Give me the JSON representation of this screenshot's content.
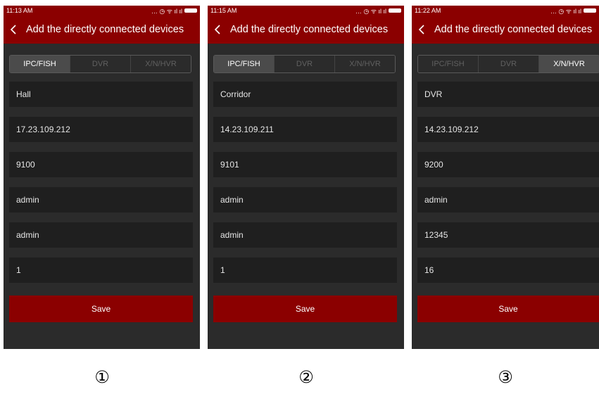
{
  "screens": [
    {
      "status_time": "11:13 AM",
      "status_icons": "… ◷ ᯤ ıl ıl",
      "title": "Add the directly connected devices",
      "tabs": [
        {
          "label": "IPC/FISH",
          "active": true
        },
        {
          "label": "DVR",
          "active": false
        },
        {
          "label": "X/N/HVR",
          "active": false
        }
      ],
      "fields": [
        "Hall",
        "17.23.109.212",
        "9100",
        "admin",
        "admin",
        "1"
      ],
      "save_label": "Save",
      "index_label": "①"
    },
    {
      "status_time": "11:15 AM",
      "status_icons": "… ◷ ᯤ ıl ıl",
      "title": "Add the directly connected devices",
      "tabs": [
        {
          "label": "IPC/FISH",
          "active": true
        },
        {
          "label": "DVR",
          "active": false
        },
        {
          "label": "X/N/HVR",
          "active": false
        }
      ],
      "fields": [
        "Corridor",
        "14.23.109.211",
        "9101",
        "admin",
        "admin",
        "1"
      ],
      "save_label": "Save",
      "index_label": "②"
    },
    {
      "status_time": "11:22 AM",
      "status_icons": "… ◷ ᯤ ıl ıl",
      "title": "Add the directly connected devices",
      "tabs": [
        {
          "label": "IPC/FISH",
          "active": false
        },
        {
          "label": "DVR",
          "active": false
        },
        {
          "label": "X/N/HVR",
          "active": true
        }
      ],
      "fields": [
        "DVR",
        "14.23.109.212",
        "9200",
        "admin",
        "12345",
        "16"
      ],
      "save_label": "Save",
      "index_label": "③"
    }
  ],
  "colors": {
    "brand_red": "#8b0000",
    "background": "#2b2b2b",
    "field_bg": "#1f1f1f",
    "active_tab_bg": "#4b4b4b"
  }
}
